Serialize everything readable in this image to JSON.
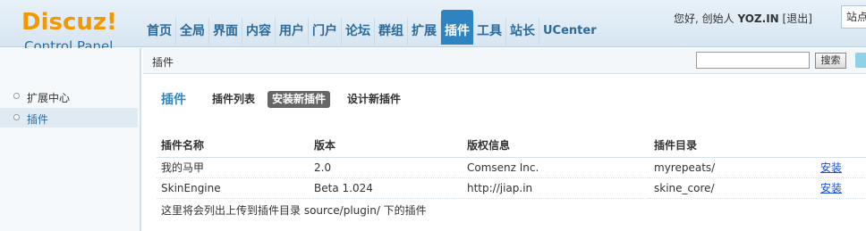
{
  "logo": {
    "title": "Discuz!",
    "subtitle": "Control Panel"
  },
  "topnav": {
    "items": [
      "首页",
      "全局",
      "界面",
      "内容",
      "用户",
      "门户",
      "论坛",
      "群组",
      "扩展",
      "插件",
      "工具",
      "站长",
      "UCenter"
    ],
    "active": "插件"
  },
  "userbar": {
    "greeting": "您好, 创始人",
    "username": "YOZ.IN",
    "logout": "退出",
    "site_label": "站点"
  },
  "subbar": {
    "breadcrumb": "插件",
    "search_button": "搜索",
    "search_value": ""
  },
  "sidebar": {
    "items": [
      {
        "label": "扩展中心",
        "active": false
      },
      {
        "label": "插件",
        "active": true
      }
    ]
  },
  "main": {
    "title": "插件",
    "tabs": [
      {
        "label": "插件列表",
        "active": false
      },
      {
        "label": "安装新插件",
        "active": true
      },
      {
        "label": "设计新插件",
        "active": false
      }
    ],
    "table": {
      "columns": [
        "插件名称",
        "版本",
        "版权信息",
        "插件目录",
        ""
      ],
      "rows": [
        [
          "我的马甲",
          "2.0",
          "Comsenz Inc.",
          "myrepeats/",
          "安装"
        ],
        [
          "SkinEngine",
          "Beta 1.024",
          "http://jiap.in",
          "skine_core/",
          "安装"
        ]
      ]
    },
    "note": "这里将会列出上传到插件目录 source/plugin/ 下的插件"
  },
  "colors": {
    "logo_orange": "#f39800",
    "nav_blue": "#2b6a9c",
    "nav_active_bg": "#2e83c1",
    "title_blue": "#2b86c7",
    "link_blue": "#1a4ed1"
  }
}
